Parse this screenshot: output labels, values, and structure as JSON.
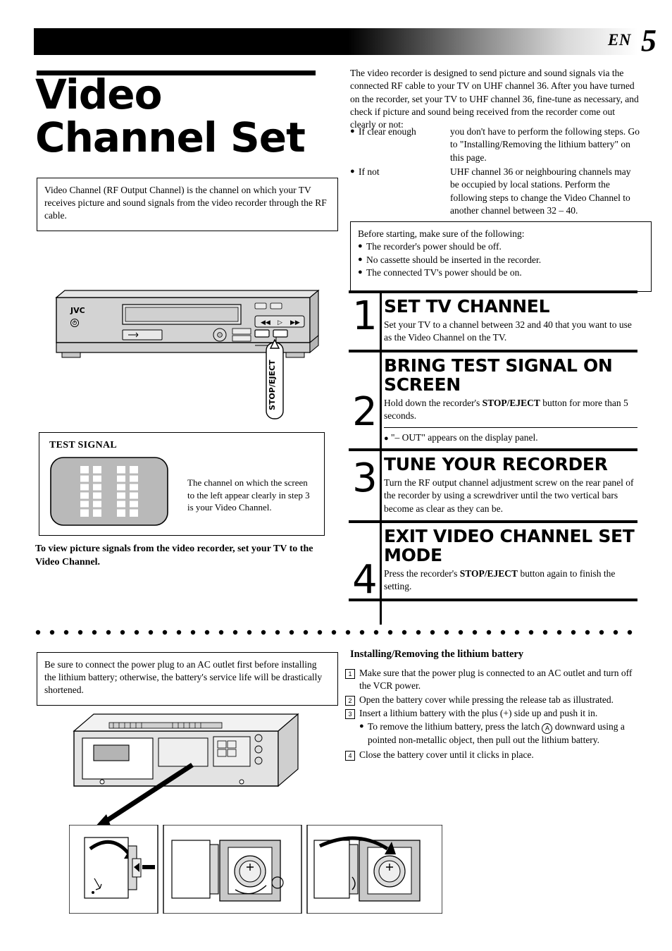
{
  "header": {
    "en_label": "EN",
    "page_number": "5"
  },
  "title": {
    "line1": "Video",
    "line2": "Channel Set"
  },
  "intro_box": {
    "text": "Video Channel (RF Output Channel) is the channel on which your TV receives picture and sound signals from the video recorder through the RF cable."
  },
  "vcr_front": {
    "brand": "JVC",
    "callout_label": "STOP/EJECT"
  },
  "test_signal": {
    "title": "TEST SIGNAL",
    "text": "The channel on which the screen to the left appear clearly in step 3 is your Video Channel.",
    "step_ref": "3"
  },
  "left_note": {
    "text": "To view picture signals from the video recorder, set your TV to the Video Channel."
  },
  "right_intro": {
    "text": "The video recorder is designed to send picture and sound signals via the connected RF cable to your TV on UHF channel 36. After you have turned on the recorder, set your TV to UHF channel 36, fine-tune as necessary, and check if picture and sound being received from the recorder come out clearly or not:"
  },
  "conditions": [
    {
      "term": "If clear enough",
      "body": "you don't have to perform the following steps. Go to \"Installing/Removing the lithium battery\" on this page."
    },
    {
      "term": "If not",
      "body": "UHF channel 36 or neighbouring channels may be occupied by local stations. Perform the following steps to change the Video Channel to another channel between 32 – 40."
    }
  ],
  "before_box": {
    "lead": "Before starting, make sure of the following:",
    "items": [
      "The recorder's power should be off.",
      "No cassette should be inserted in the recorder.",
      "The connected TV's power should be on."
    ]
  },
  "steps": [
    {
      "number": "1",
      "heading": "SET TV CHANNEL",
      "body": "Set your TV to a channel between 32 and 40 that you want to use as the Video Channel on the TV.",
      "sub": ""
    },
    {
      "number": "2",
      "heading": "BRING TEST SIGNAL ON SCREEN",
      "body_pre": "Hold down the recorder's ",
      "body_bold": "STOP/EJECT",
      "body_post": " button for more than 5 seconds.",
      "sub": "\"– OUT\" appears on the display panel."
    },
    {
      "number": "3",
      "heading": "TUNE YOUR RECORDER",
      "body": "Turn the RF output channel adjustment screw on the rear panel of the recorder by using a screwdriver until the two vertical bars become as clear as they can be.",
      "sub": ""
    },
    {
      "number": "4",
      "heading": "EXIT VIDEO CHANNEL SET MODE",
      "body_pre": "Press the recorder's ",
      "body_bold": "STOP/EJECT",
      "body_post": " button again to finish the setting.",
      "sub": ""
    }
  ],
  "warn_box": {
    "text": "Be sure to connect the power plug to an AC outlet first before installing the lithium battery; otherwise, the battery's service life will be drastically shortened."
  },
  "lithium": {
    "title": "Installing/Removing the lithium battery",
    "items": [
      {
        "num": "1",
        "text": "Make sure that the power plug is connected to an AC outlet and turn off the VCR power."
      },
      {
        "num": "2",
        "text": "Open the battery cover while pressing the release tab as illustrated."
      },
      {
        "num": "3",
        "text": "Insert a lithium battery with the plus (+) side up and push it in."
      },
      {
        "num": "4",
        "text": "Close the battery cover until it clicks in place."
      }
    ],
    "sub_item": {
      "pre": "To remove the lithium battery, press the latch ",
      "mark": "A",
      "post": " downward using a pointed non-metallic object, then pull out the lithium battery."
    }
  },
  "colors": {
    "ink": "#000000",
    "panel_fill": "#d8d8d8",
    "screen_fill": "#bdbdbd"
  }
}
